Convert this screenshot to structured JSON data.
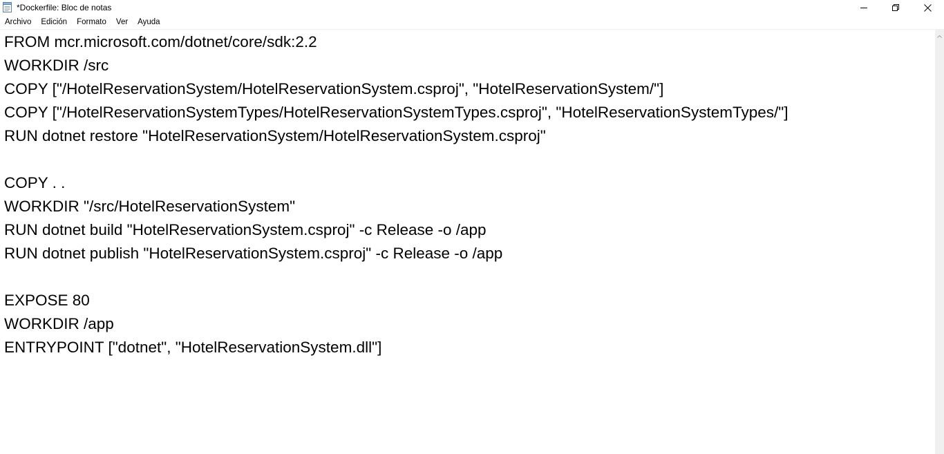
{
  "window": {
    "title": "*Dockerfile: Bloc de notas",
    "icon": "notepad-icon"
  },
  "caption_buttons": {
    "minimize_icon": "minimize-icon",
    "maximize_icon": "restore-icon",
    "close_icon": "close-icon"
  },
  "menu": {
    "items": [
      "Archivo",
      "Edición",
      "Formato",
      "Ver",
      "Ayuda"
    ]
  },
  "editor": {
    "lines": [
      "FROM mcr.microsoft.com/dotnet/core/sdk:2.2",
      "WORKDIR /src",
      "COPY [\"/HotelReservationSystem/HotelReservationSystem.csproj\", \"HotelReservationSystem/\"]",
      "COPY [\"/HotelReservationSystemTypes/HotelReservationSystemTypes.csproj\", \"HotelReservationSystemTypes/\"]",
      "RUN dotnet restore \"HotelReservationSystem/HotelReservationSystem.csproj\"",
      "",
      "COPY . .",
      "WORKDIR \"/src/HotelReservationSystem\"",
      "RUN dotnet build \"HotelReservationSystem.csproj\" -c Release -o /app",
      "RUN dotnet publish \"HotelReservationSystem.csproj\" -c Release -o /app",
      "",
      "EXPOSE 80",
      "WORKDIR /app",
      "ENTRYPOINT [\"dotnet\", \"HotelReservationSystem.dll\"]"
    ]
  }
}
